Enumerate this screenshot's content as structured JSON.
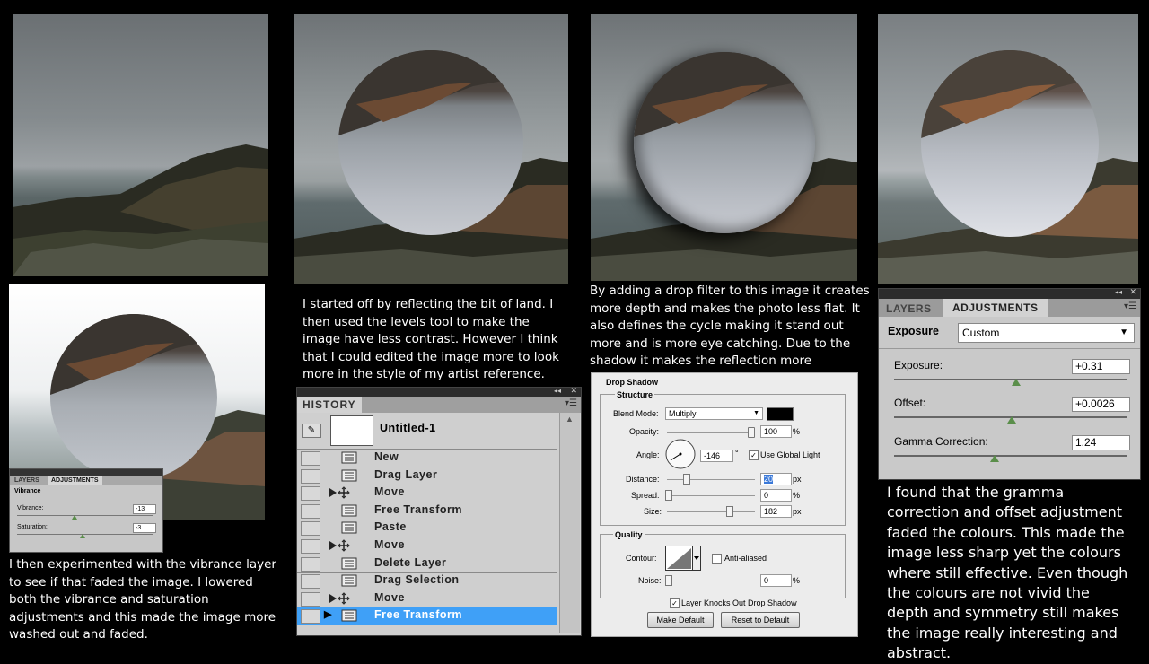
{
  "captions": {
    "reflect": "I started off by reflecting the bit of land. I then used the levels tool to make the image have less contrast. However I think that I could edited the image more to look more in the style of my artist reference.",
    "drop": "By adding a drop filter to this image it creates more depth and makes the photo less flat. It also defines the cycle making it stand out more and is more eye catching.  Due to the shadow it makes the reflection more noticeable.",
    "vibrance": "I then experimented with the  vibrance layer to see if that faded the image. I lowered both the vibrance and saturation adjustments and this made the image more  washed out and faded.",
    "gamma": "I found that the gramma correction and offset adjustment faded the colours. This made the image less sharp yet the colours where still effective. Even though the colours are not vivid the depth and symmetry still makes the image really interesting and abstract."
  },
  "vibrance_panel": {
    "tab_layers": "LAYERS",
    "tab_adjustments": "ADJUSTMENTS",
    "heading": "Vibrance",
    "vibrance_label": "Vibrance:",
    "vibrance_value": "-13",
    "saturation_label": "Saturation:",
    "saturation_value": "-3"
  },
  "history": {
    "title": "HISTORY",
    "snapshot": "Untitled-1",
    "items": [
      {
        "label": "New",
        "icon": "document-icon"
      },
      {
        "label": "Drag Layer",
        "icon": "document-icon"
      },
      {
        "label": "Move",
        "icon": "move-icon"
      },
      {
        "label": "Free Transform",
        "icon": "document-icon"
      },
      {
        "label": "Paste",
        "icon": "document-icon"
      },
      {
        "label": "Move",
        "icon": "move-icon"
      },
      {
        "label": "Delete Layer",
        "icon": "document-icon"
      },
      {
        "label": "Drag Selection",
        "icon": "document-icon"
      },
      {
        "label": "Move",
        "icon": "move-icon"
      },
      {
        "label": "Free Transform",
        "icon": "document-icon"
      }
    ]
  },
  "drop_shadow": {
    "title": "Drop Shadow",
    "structure": "Structure",
    "blend_mode_label": "Blend Mode:",
    "blend_mode_value": "Multiply",
    "opacity_label": "Opacity:",
    "opacity_value": "100",
    "percent": "%",
    "angle_label": "Angle:",
    "angle_value": "-146",
    "degree": "°",
    "global_light_label": "Use Global Light",
    "distance_label": "Distance:",
    "distance_value": "20",
    "spread_label": "Spread:",
    "spread_value": "0",
    "size_label": "Size:",
    "size_value": "182",
    "px": "px",
    "quality": "Quality",
    "contour_label": "Contour:",
    "anti_aliased_label": "Anti-aliased",
    "noise_label": "Noise:",
    "noise_value": "0",
    "knockout_label": "Layer Knocks Out Drop Shadow",
    "make_default": "Make Default",
    "reset_default": "Reset to Default"
  },
  "exposure_panel": {
    "tab_layers": "LAYERS",
    "tab_adjustments": "ADJUSTMENTS",
    "heading": "Exposure",
    "preset_value": "Custom",
    "exposure_label": "Exposure:",
    "exposure_value": "+0.31",
    "offset_label": "Offset:",
    "offset_value": "+0.0026",
    "gamma_label": "Gamma Correction:",
    "gamma_value": "1.24"
  }
}
